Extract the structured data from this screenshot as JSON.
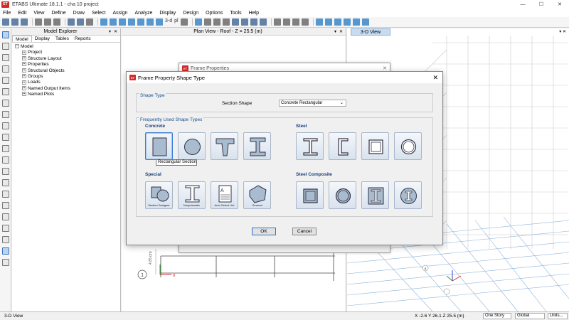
{
  "window": {
    "title": "ETABS Ultimate 18.1.1 - cha 10 project",
    "logo_text": "ET",
    "controls": [
      "—",
      "☐",
      "✕"
    ]
  },
  "menu": [
    "File",
    "Edit",
    "View",
    "Define",
    "Draw",
    "Select",
    "Assign",
    "Analyze",
    "Display",
    "Design",
    "Options",
    "Tools",
    "Help"
  ],
  "toolbar": {
    "view_3d_label": "3-d",
    "plan_label": "pl"
  },
  "model_explorer": {
    "title": "Model Explorer",
    "tabs": [
      "Model",
      "Display",
      "Tables",
      "Reports"
    ],
    "root": "Model",
    "items": [
      "Project",
      "Structure Layout",
      "Properties",
      "Structural Objects",
      "Groups",
      "Loads",
      "Named Output Items",
      "Named Plots"
    ]
  },
  "plan_view": {
    "title": "Plan View - Roof - Z = 25.5 (m)",
    "dim_label": "4.85 (m)",
    "grid_bubble": "1"
  },
  "view3d": {
    "title": "3-D View",
    "grid_bubble": "8"
  },
  "bg_dialog": {
    "title": "Frame Properties"
  },
  "dialog": {
    "title": "Frame Property Shape Type",
    "shape_type_group": "Shape Type",
    "section_shape_label": "Section Shape",
    "section_shape_value": "Concrete Rectangular",
    "frequent_group": "Frequently Used Shape Types",
    "concrete_label": "Concrete",
    "steel_label": "Steel",
    "special_label": "Special",
    "steel_composite_label": "Steel Composite",
    "tooltip": "Rectangular Section",
    "special_captions": [
      "Section Designer",
      "Nonprismatic",
      "Auto Select List",
      "General"
    ],
    "ok": "OK",
    "cancel": "Cancel"
  },
  "status": {
    "left": "3-D View",
    "coords": "X -2.6  Y 26.1  Z 25.5 (m)",
    "story": "One Story",
    "coord_sys": "Global",
    "units": "Units..."
  },
  "colors": {
    "accent": "#3c7fd5",
    "logo": "#d42a2a",
    "group_title": "#1a4e91"
  }
}
